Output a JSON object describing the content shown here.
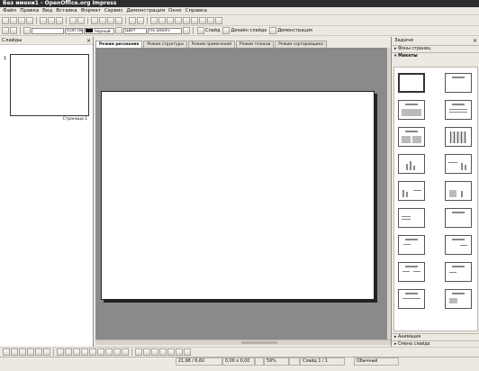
{
  "window": {
    "title": "Без имени1 - OpenOffice.org Impress"
  },
  "menu": [
    "Файл",
    "Правка",
    "Вид",
    "Вставка",
    "Формат",
    "Сервис",
    "Демонстрация",
    "Окно",
    "Справка"
  ],
  "toolbar2": {
    "slide_button": "Слайд",
    "slide_design_button": "Дизайн слайда",
    "demonstration_button": "Демонстрация"
  },
  "toolbar3": {
    "line_width": "0,00 см",
    "line_color": "Черный",
    "area_style": "Цвет",
    "area_color": "По умолч."
  },
  "slides_panel": {
    "title": "Слайды",
    "items": [
      {
        "number": "1",
        "name": "Страница 1"
      }
    ]
  },
  "tabs": [
    "Режим рисования",
    "Режим структуры",
    "Режим примечаний",
    "Режим тезисов",
    "Режим сортировщика"
  ],
  "active_tab": "Режим рисования",
  "tasks_panel": {
    "title": "Задачи",
    "sections_top": [
      "Фоны страниц",
      "Макеты"
    ],
    "open_section": "Макеты",
    "sections_bottom": [
      "Анимация",
      "Смена слайда"
    ]
  },
  "status": {
    "position": "21,98 / 6,60",
    "size": "0,00 x 0,00",
    "zoom": "59%",
    "slide": "Слайд 1 / 1",
    "layout": "Обычный"
  },
  "colors": {
    "titlebar": "#2d2d2d",
    "chrome": "#ece9e2",
    "canvas": "#8a8a8a"
  }
}
